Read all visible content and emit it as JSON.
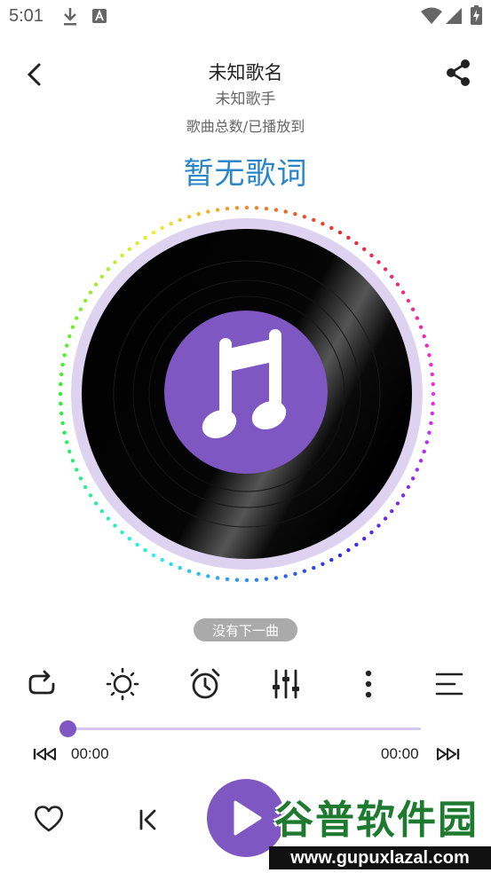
{
  "status_bar": {
    "time": "5:01",
    "left_icons": [
      "download-icon",
      "a-notification-icon"
    ],
    "right_icons": [
      "wifi-icon",
      "signal-icon",
      "battery-icon"
    ]
  },
  "header": {
    "back_icon": "chevron-left-icon",
    "share_icon": "share-icon",
    "title": "未知歌名",
    "artist": "未知歌手",
    "progress_text": "歌曲总数/已播放到"
  },
  "lyrics": {
    "text": "暂无歌词",
    "color": "#2a86c8"
  },
  "record": {
    "center_icon": "music-note-icon",
    "accent": "#7e57c2"
  },
  "next_tip": {
    "label": "没有下一曲"
  },
  "function_row": [
    {
      "name": "repeat-icon"
    },
    {
      "name": "brightness-icon"
    },
    {
      "name": "alarm-clock-icon"
    },
    {
      "name": "equalizer-icon"
    },
    {
      "name": "more-vertical-icon"
    },
    {
      "name": "playlist-icon"
    }
  ],
  "seek": {
    "progress": 0,
    "current_time": "00:00",
    "total_time": "00:00"
  },
  "controls": {
    "favorite_icon": "heart-icon",
    "prev_icon": "previous-icon",
    "play_icon": "play-icon"
  },
  "watermark": {
    "name": "谷普软件园",
    "url": "www.gupuxlazal.com"
  }
}
